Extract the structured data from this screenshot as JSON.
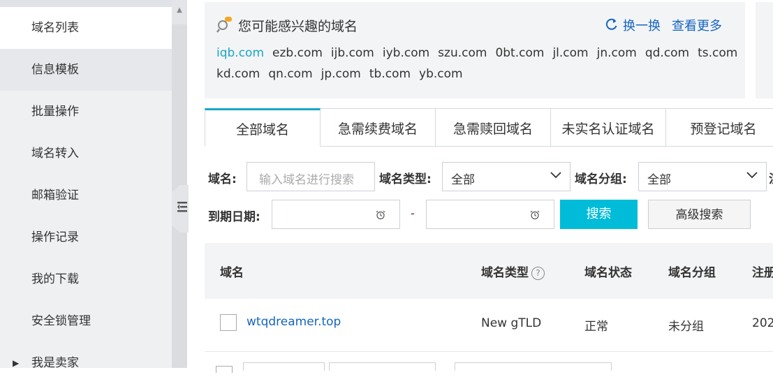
{
  "sidebar": {
    "items": [
      {
        "label": "域名列表"
      },
      {
        "label": "信息模板"
      },
      {
        "label": "批量操作"
      },
      {
        "label": "域名转入"
      },
      {
        "label": "邮箱验证"
      },
      {
        "label": "操作记录"
      },
      {
        "label": "我的下载"
      },
      {
        "label": "安全锁管理"
      },
      {
        "label": "我是卖家"
      }
    ],
    "collapse_icon": "collapse-sidebar-icon"
  },
  "suggest": {
    "title": "您可能感兴趣的域名",
    "swap_label": "换一换",
    "more_label": "查看更多",
    "domains": [
      "iqb.com",
      "ezb.com",
      "ijb.com",
      "iyb.com",
      "szu.com",
      "0bt.com",
      "jl.com",
      "jn.com",
      "qd.com",
      "ts.com",
      "kd.com",
      "qn.com",
      "jp.com",
      "tb.com",
      "yb.com"
    ]
  },
  "tabs": [
    {
      "label": "全部域名"
    },
    {
      "label": "急需续费域名"
    },
    {
      "label": "急需赎回域名"
    },
    {
      "label": "未实名认证域名"
    },
    {
      "label": "预登记域名"
    }
  ],
  "filters": {
    "domain_label": "域名:",
    "domain_placeholder": "输入域名进行搜索",
    "type_label": "域名类型:",
    "type_value": "全部",
    "group_label": "域名分组:",
    "group_value": "全部",
    "extra_label": "注",
    "expire_label": "到期日期:",
    "dash": "-",
    "search_button": "搜索",
    "advanced_button": "高级搜索"
  },
  "table": {
    "headers": {
      "domain": "域名",
      "type": "域名类型",
      "status": "域名状态",
      "group": "域名分组",
      "reg": "注册"
    },
    "rows": [
      {
        "domain": "wtqdreamer.top",
        "type": "New gTLD",
        "status": "正常",
        "group": "未分组",
        "reg": "202"
      }
    ]
  },
  "colors": {
    "accent": "#19a6c4",
    "link": "#1565c0",
    "button": "#00bcd8"
  }
}
